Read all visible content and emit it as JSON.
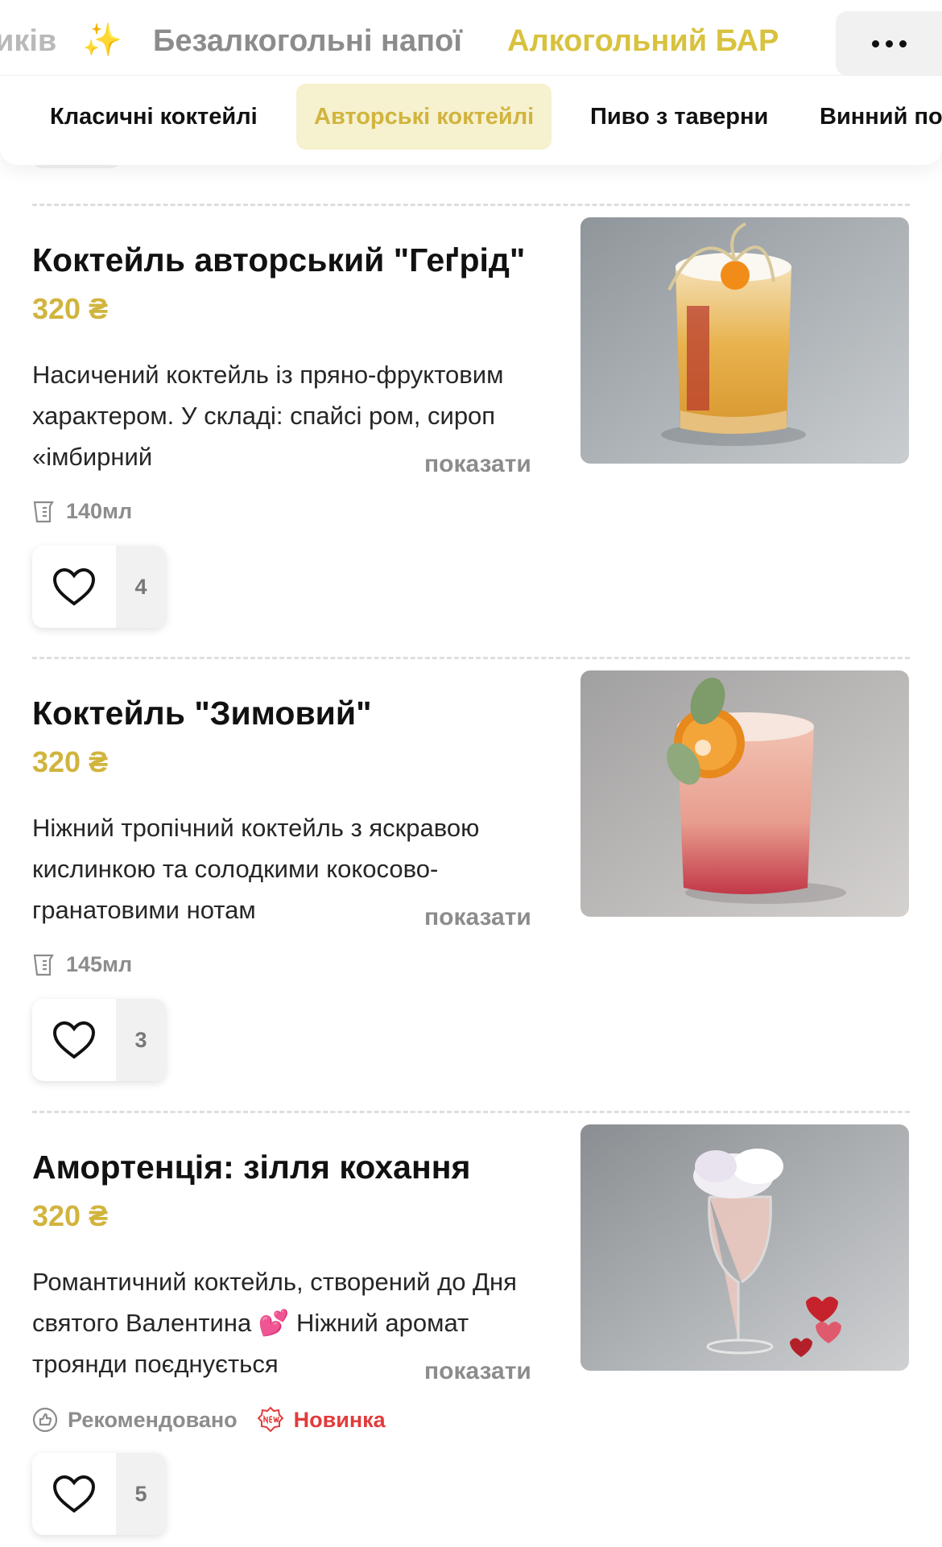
{
  "nav": {
    "categories": [
      "иків",
      "✨",
      "Безалкогольні напої",
      "Алкогольний БАР"
    ],
    "subcategories": [
      "Класичні коктейлі",
      "Авторські коктейлі",
      "Пиво з таверни",
      "Винний по"
    ],
    "active_subcategory": "Авторські коктейлі"
  },
  "labels": {
    "show_more": "показати"
  },
  "items": [
    {
      "title": "Коктейль авторський \"Геґрід\"",
      "price": "320 ₴",
      "description": "Насичений коктейль із пряно-фруктовим характером. У складі: спайсі ром, сироп «імбирний",
      "volume": "140мл",
      "likes": "4"
    },
    {
      "title": "Коктейль \"Зимовий\"",
      "price": "320 ₴",
      "description": "Ніжний тропічний коктейль з яскравою кислинкою та солодкими кокосово-гранатовими нотам",
      "volume": "145мл",
      "likes": "3"
    },
    {
      "title": "Амортенція: зілля кохання",
      "price": "320 ₴",
      "description": "Романтичний коктейль, створений до Дня святого Валентина 💕 Ніжний аромат троянди поєднується",
      "tags": [
        "Рекомендовано",
        "Новинка"
      ],
      "likes": "5"
    }
  ],
  "colors": {
    "accent": "#d1b43e",
    "accent_bg": "#f6f1cf",
    "new_badge": "#e23b3b",
    "muted": "#8c8c8c"
  }
}
